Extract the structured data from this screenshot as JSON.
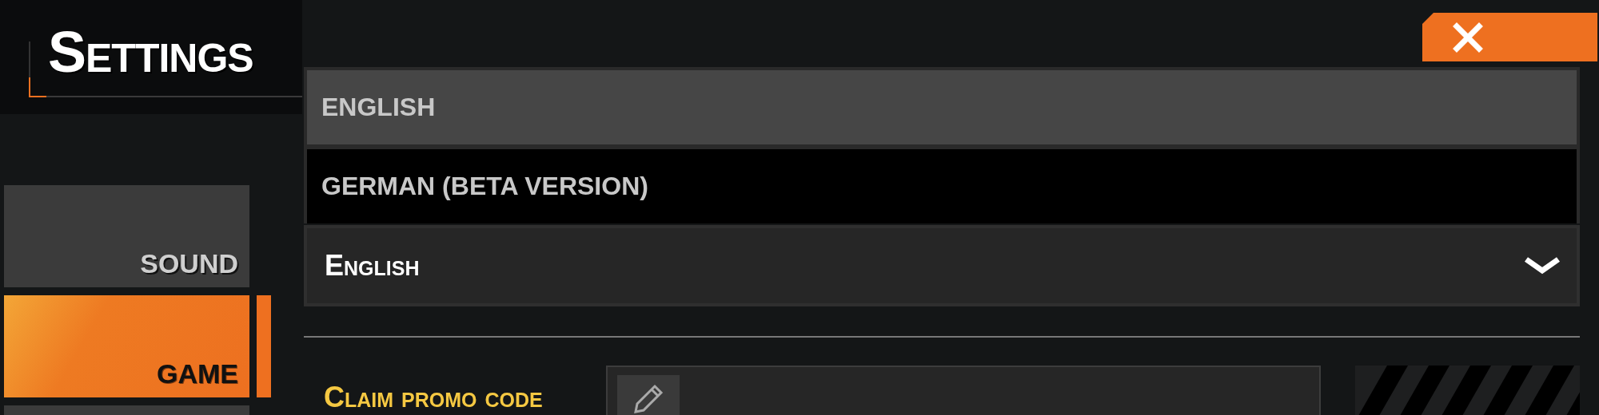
{
  "title": "Settings",
  "sidebar": {
    "items": [
      {
        "label": "SOUND",
        "selected": false
      },
      {
        "label": "GAME",
        "selected": true
      }
    ]
  },
  "language": {
    "expanded": true,
    "value": "English",
    "options": [
      {
        "label": "ENGLISH",
        "selected": true
      },
      {
        "label": "GERMAN (BETA VERSION)",
        "selected": false
      }
    ]
  },
  "promo": {
    "label": "Claim promo code"
  }
}
